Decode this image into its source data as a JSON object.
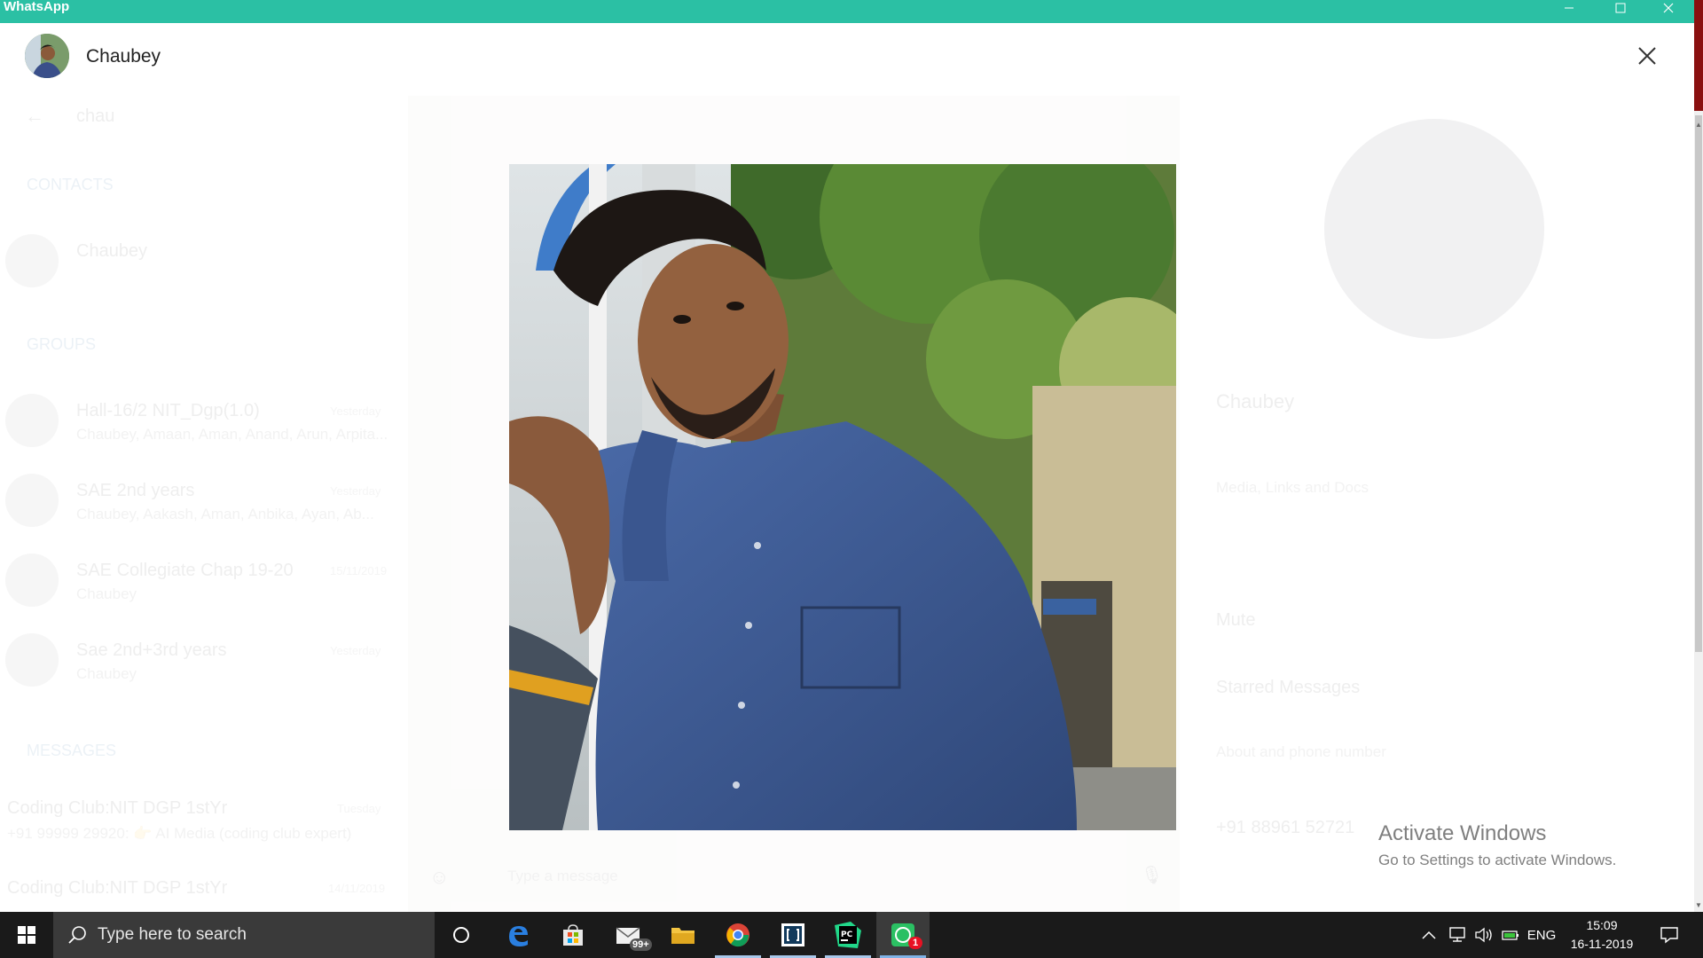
{
  "window": {
    "title": "WhatsApp"
  },
  "viewer": {
    "contact_name": "Chaubey"
  },
  "underlay": {
    "search_value": "chau",
    "section_contacts": "CONTACTS",
    "section_groups": "GROUPS",
    "section_messages": "MESSAGES",
    "contact": {
      "name": "Chaubey"
    },
    "groups": [
      {
        "name": "Hall-16/2 NIT_Dgp(1.0)",
        "sub": "Chaubey, Amaan, Aman, Anand, Arun, Arpita...",
        "time": "Yesterday"
      },
      {
        "name": "SAE 2nd years",
        "sub": "Chaubey, Aakash, Aman, Anbika, Ayan, Ab...",
        "time": "Yesterday"
      },
      {
        "name": "SAE Collegiate Chap 19-20",
        "sub": "Chaubey",
        "time": "15/11/2019"
      },
      {
        "name": "Sae 2nd+3rd years",
        "sub": "Chaubey",
        "time": "Yesterday"
      }
    ],
    "messages": [
      {
        "name": "Coding Club:NIT DGP 1stYr",
        "sub": "+91 99999 29920: 👉 AI Media (coding club expert)",
        "time": "Tuesday"
      },
      {
        "name": "Coding Club:NIT DGP 1stYr",
        "sub": "",
        "time": "14/11/2019"
      }
    ],
    "compose_placeholder": "Type a message",
    "profile": {
      "name": "Chaubey",
      "media_label": "Media, Links and Docs",
      "mute_label": "Mute",
      "starred_label": "Starred Messages",
      "about_label": "About and phone number",
      "phone": "+91 88961 52721"
    }
  },
  "watermark": {
    "title": "Activate Windows",
    "subtitle": "Go to Settings to activate Windows."
  },
  "taskbar": {
    "search_placeholder": "Type here to search",
    "mail_badge": "99+",
    "whatsapp_badge": "1",
    "language": "ENG",
    "time": "15:09",
    "date": "16-11-2019"
  },
  "colors": {
    "titlebar": "#2bc0a4",
    "taskbar": "#1a1a1a",
    "search_box": "#3a3a3a",
    "watermark_text": "#7f7f7f"
  },
  "icons": {
    "minimize": "minimize-icon",
    "maximize": "maximize-icon",
    "close": "close-icon",
    "start": "windows-logo-icon",
    "search": "search-icon",
    "cortana": "cortana-circle-icon",
    "edge": "edge-browser-icon",
    "store": "microsoft-store-icon",
    "mail": "mail-icon",
    "explorer": "file-explorer-icon",
    "chrome": "chrome-icon",
    "bracket": "code-editor-icon",
    "pycharm": "pycharm-icon",
    "whatsapp": "whatsapp-icon"
  }
}
